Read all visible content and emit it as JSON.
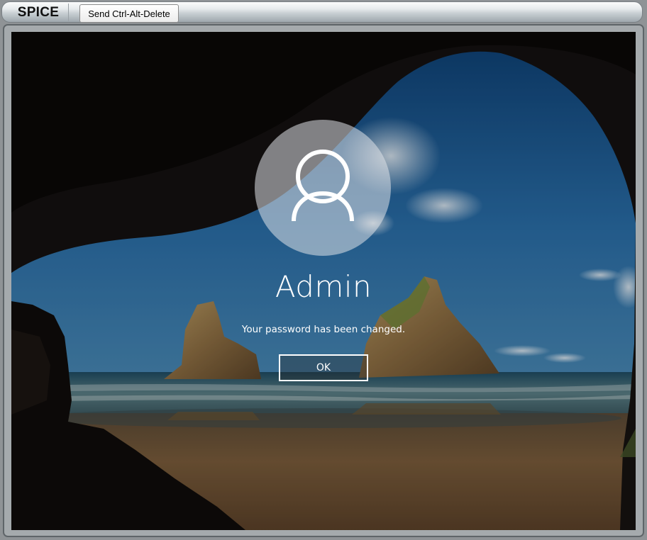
{
  "app": {
    "title": "SPICE"
  },
  "toolbar": {
    "send_cad_label": "Send Ctrl-Alt-Delete"
  },
  "login": {
    "username": "Admin",
    "message": "Your password has been changed.",
    "ok_label": "OK",
    "avatar_icon": "user-icon"
  },
  "colors": {
    "sky": "#1e5d9a",
    "sea": "#2a6f86",
    "sand": "#6b5236",
    "cave": "#120f0c",
    "button_border": "#ffffff"
  }
}
